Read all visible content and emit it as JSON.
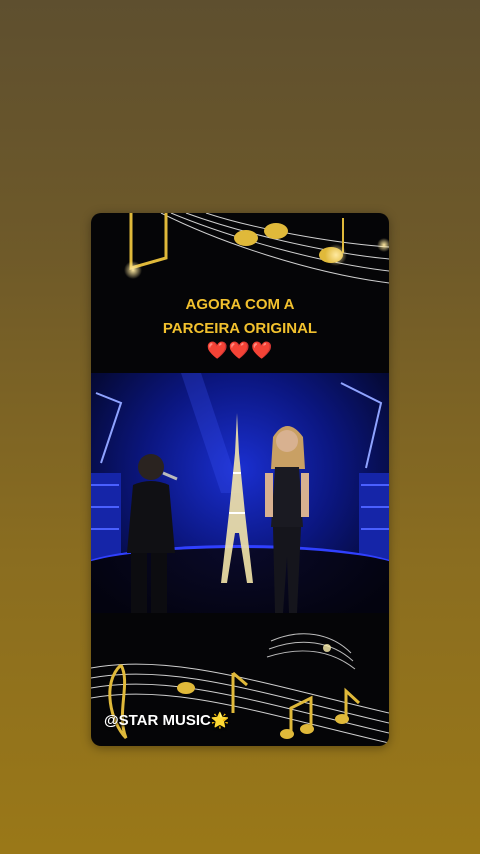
{
  "story": {
    "caption_line1": "AGORA COM A",
    "caption_line2": "PARCEIRA ORIGINAL",
    "hearts": "❤️❤️❤️",
    "watermark": "@STAR MUSIC",
    "watermark_star": "🌟"
  },
  "colors": {
    "background_top": "#5e4f2f",
    "background_bottom": "#9a7818",
    "caption": "#f2c12e",
    "stage_blue": "#1a2fd0"
  },
  "icons": {
    "top_decoration": "music-notes-icon",
    "bottom_decoration": "music-staff-icon"
  }
}
